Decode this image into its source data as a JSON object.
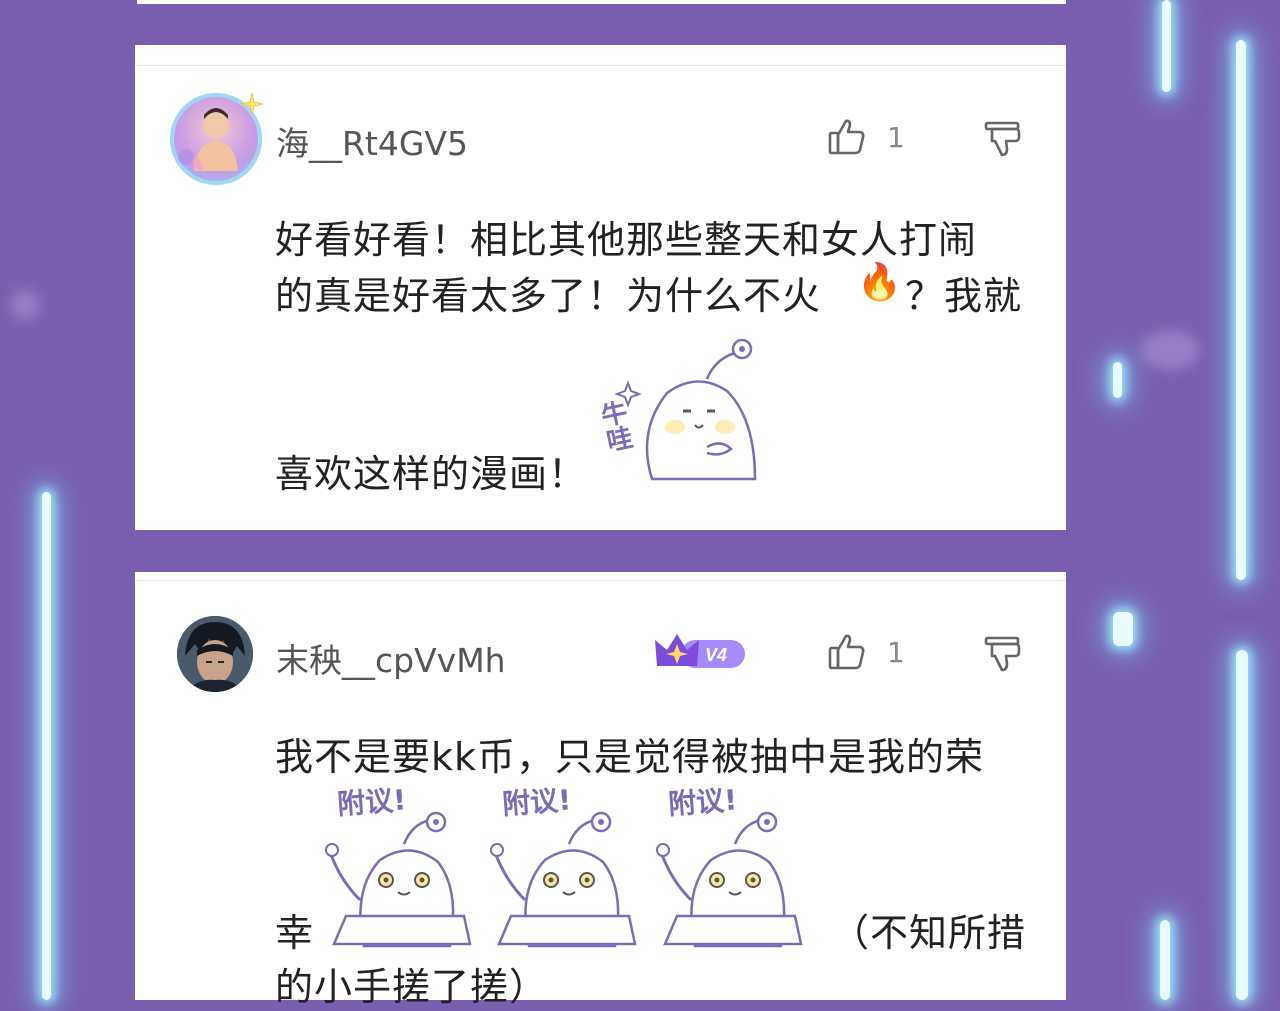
{
  "comments": [
    {
      "username": "海__Rt4GV5",
      "likes": "1",
      "text_lines": [
        "好看好看！相比其他那些整天和女人打闹",
        "的真是好看太多了！为什么不火",
        "？我就",
        "喜欢这样的漫画！"
      ],
      "fire_emoji": "🔥",
      "sticker_text": "牛哇"
    },
    {
      "username": "末秧__cpVvMh",
      "badge_level": "V4",
      "likes": "1",
      "text_lines": [
        "我不是要kk币，只是觉得被抽中是我的荣",
        "幸",
        "（不知所措",
        "的小手搓了搓）"
      ],
      "sticker_text": "附议!"
    }
  ],
  "colors": {
    "background": "#7a5fb0",
    "card": "#ffffff",
    "badge": "#8b5cf6",
    "text": "#222222",
    "username": "#555555"
  }
}
